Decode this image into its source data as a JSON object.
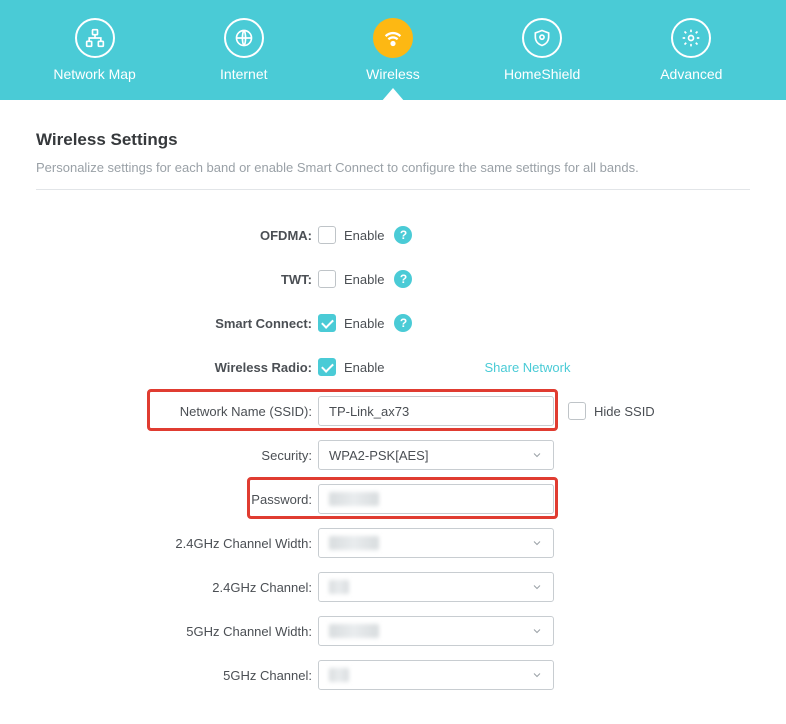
{
  "nav": {
    "items": [
      {
        "label": "Network Map"
      },
      {
        "label": "Internet"
      },
      {
        "label": "Wireless"
      },
      {
        "label": "HomeShield"
      },
      {
        "label": "Advanced"
      }
    ]
  },
  "section": {
    "title": "Wireless Settings",
    "desc": "Personalize settings for each band or enable Smart Connect to configure the same settings for all bands."
  },
  "labels": {
    "ofdma": "OFDMA:",
    "twt": "TWT:",
    "smart_connect": "Smart Connect:",
    "wireless_radio": "Wireless Radio:",
    "ssid": "Network Name (SSID):",
    "security": "Security:",
    "password": "Password:",
    "ch_width_24": "2.4GHz Channel Width:",
    "ch_24": "2.4GHz Channel:",
    "ch_width_5": "5GHz Channel Width:",
    "ch_5": "5GHz Channel:",
    "enable": "Enable",
    "share": "Share Network",
    "hide_ssid": "Hide SSID"
  },
  "values": {
    "ssid": "TP-Link_ax73",
    "security": "WPA2-PSK[AES]",
    "password": "",
    "ch_width_24": "",
    "ch_24": "",
    "ch_width_5": "",
    "ch_5": ""
  },
  "checked": {
    "ofdma": false,
    "twt": false,
    "smart_connect": true,
    "wireless_radio": true,
    "hide_ssid": false
  }
}
